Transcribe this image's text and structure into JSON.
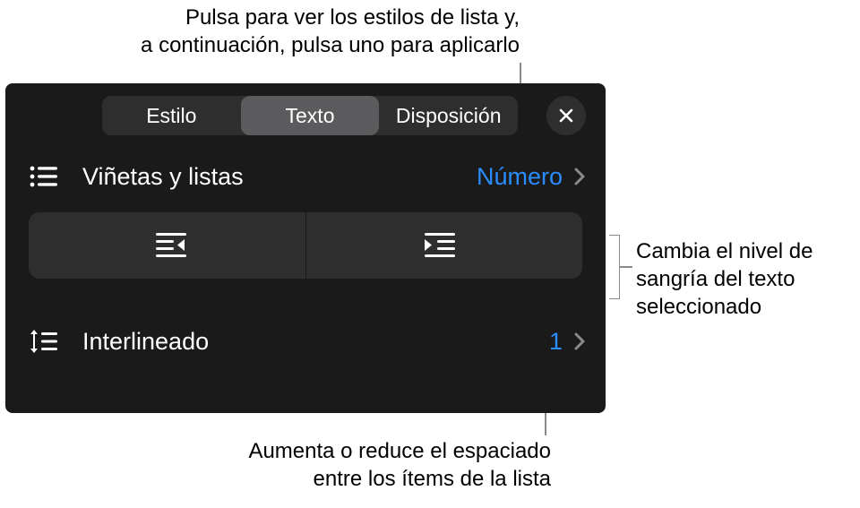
{
  "callouts": {
    "top1": "Pulsa para ver los estilos de lista y,",
    "top2": "a continuación, pulsa uno para aplicarlo",
    "right1": "Cambia el nivel de",
    "right2": "sangría del texto",
    "right3": "seleccionado",
    "bottom1": "Aumenta o reduce el espaciado",
    "bottom2": "entre los ítems de la lista"
  },
  "tabs": {
    "style": "Estilo",
    "text": "Texto",
    "layout": "Disposición"
  },
  "rows": {
    "bullets_label": "Viñetas y listas",
    "bullets_value": "Número",
    "spacing_label": "Interlineado",
    "spacing_value": "1"
  },
  "colors": {
    "accent": "#2a8dff"
  }
}
